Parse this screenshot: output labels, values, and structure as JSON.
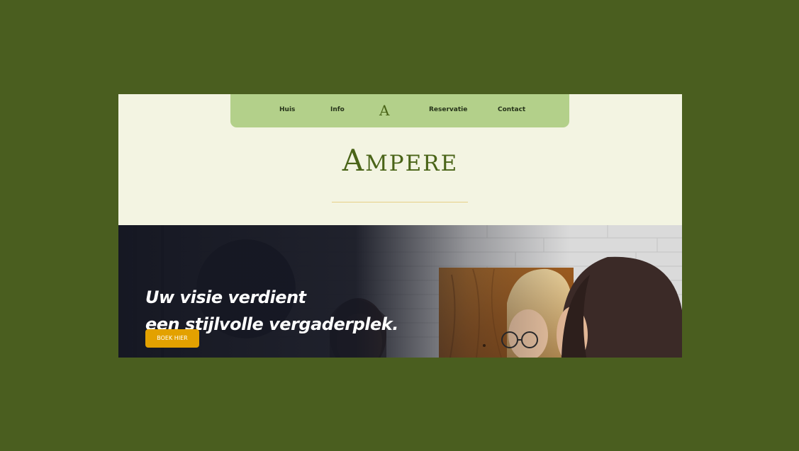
{
  "nav": {
    "items": [
      {
        "label": "Huis"
      },
      {
        "label": "Info"
      },
      {
        "label": "Reservatie"
      },
      {
        "label": "Contact"
      }
    ],
    "logo_letter": "A"
  },
  "brand": {
    "initial": "A",
    "rest": "MPERE"
  },
  "hero": {
    "line1": "Uw visie verdient",
    "line2": "een stijlvolle vergaderplek.",
    "cta_label": "BOEK HIER"
  },
  "colors": {
    "page_background": "#4a5e1f",
    "cream": "#f3f4e2",
    "nav_green": "#b3d08a",
    "brand_green": "#4a6418",
    "accent_gold": "#e3a100",
    "rule_gold": "#e6cf86"
  }
}
